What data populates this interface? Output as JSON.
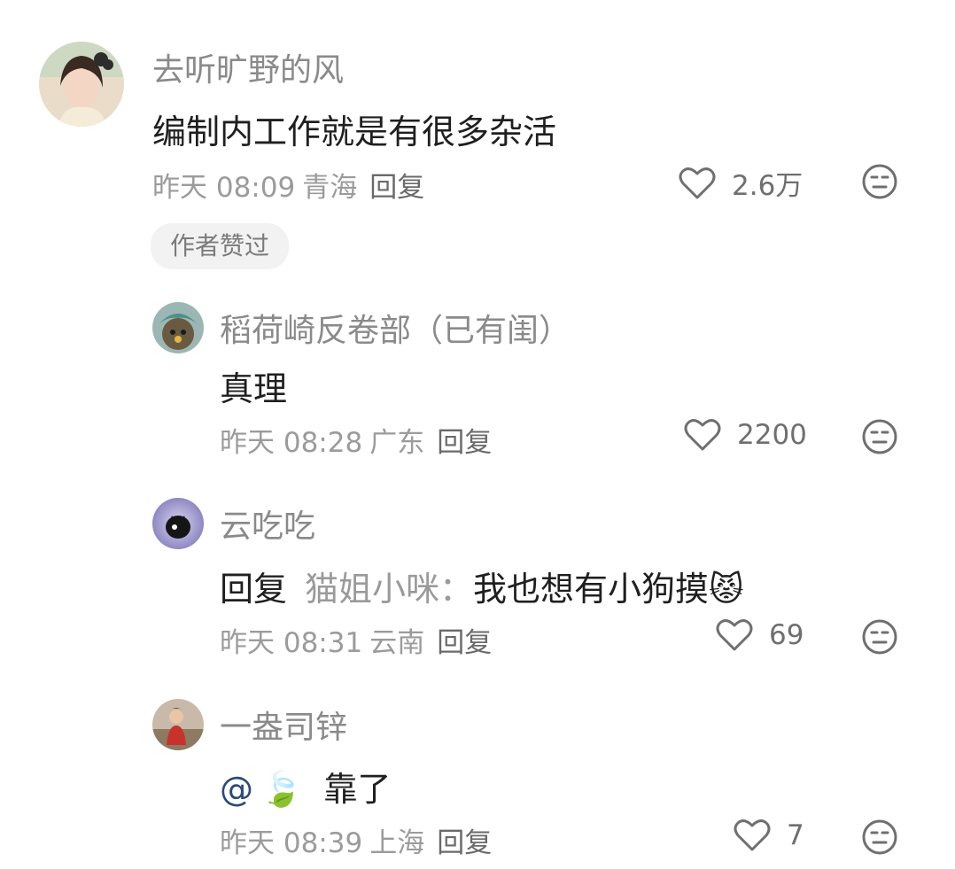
{
  "comments": [
    {
      "username": "去听旷野的风",
      "content": "编制内工作就是有很多杂活",
      "time": "昨天 08:09",
      "location": "青海",
      "reply_label": "回复",
      "likes": "2.6万",
      "badge": "作者赞过"
    },
    {
      "username": "稻荷崎反卷部（已有闺）",
      "content": "真理",
      "time": "昨天 08:28",
      "location": "广东",
      "reply_label": "回复",
      "likes": "2200"
    },
    {
      "username": "云吃吃",
      "reply_prefix": "回复",
      "reply_target": "猫姐小咪：",
      "content": "我也想有小狗摸",
      "emoji": "😾",
      "time": "昨天 08:31",
      "location": "云南",
      "reply_label": "回复",
      "likes": "69"
    },
    {
      "username": "一盎司锌",
      "mention": "@",
      "mention_emoji": "🍃",
      "content": "靠了",
      "time": "昨天 08:39",
      "location": "上海",
      "reply_label": "回复",
      "likes": "7"
    }
  ],
  "icons": {
    "like": "heart-outline-icon",
    "dislike": "neutral-face-icon"
  },
  "colors": {
    "username": "#8a8a8a",
    "content": "#1f1f1f",
    "meta": "#9b9b9b",
    "badge_bg": "#f2f2f2"
  }
}
